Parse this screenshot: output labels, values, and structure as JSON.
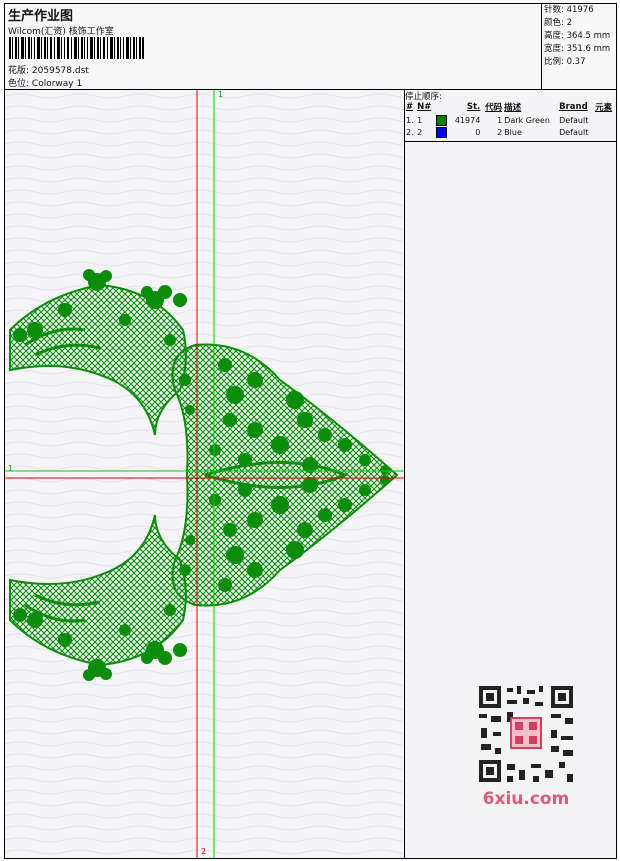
{
  "header": {
    "title": "生产作业图",
    "subtitle": "Wilcom(汇资) 核饰工作室",
    "design_label": "花版:",
    "design_value": "2059578.dst",
    "colorway_label": "色位:",
    "colorway_value": "Colorway 1"
  },
  "stats": {
    "stitches": "针数: 41976",
    "colors": "颜色: 2",
    "height": "高度: 364.5 mm",
    "width": "宽度: 351.6 mm",
    "scale": "比例: 0.37"
  },
  "stop_sequence": {
    "title": "停止顺序:",
    "headers": [
      "#",
      "N#",
      "",
      "St.",
      "代码",
      "描述",
      "Brand",
      "元素"
    ],
    "rows": [
      {
        "index": "1.",
        "needle": "1",
        "color": "#008000",
        "stitches": "41974",
        "code": "1",
        "desc": "Dark Green",
        "brand": "Default"
      },
      {
        "index": "2.",
        "needle": "2",
        "color": "#0000ff",
        "stitches": "0",
        "code": "2",
        "desc": "Blue",
        "brand": "Default"
      }
    ]
  },
  "axes": {
    "v_top": "1",
    "h_left": "1",
    "h_bottom": "2"
  },
  "colors": {
    "embroidery": "#0b8c0b",
    "red_axis": "#e00000",
    "green_axis": "#00d000"
  },
  "watermark": {
    "text": "6xiu.com"
  }
}
